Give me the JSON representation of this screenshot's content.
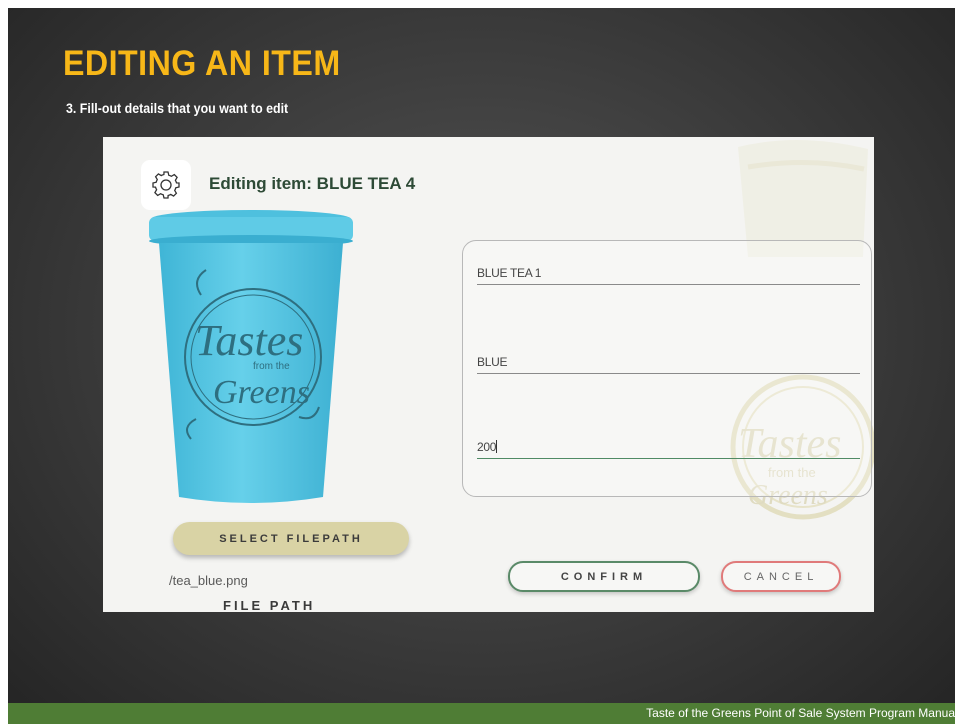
{
  "slide": {
    "title": "EDITING AN ITEM",
    "subtitle": "3.  Fill-out details that you want to edit",
    "footer": "Taste of the Greens Point of Sale System Program Manua"
  },
  "app": {
    "window_title": "Editing item: BLUE TEA 4",
    "settings_icon": "gear-icon",
    "product_image": "blue-cup-image",
    "logo_text": {
      "line1": "Tastes",
      "line2": "from the",
      "line3": "Greens"
    },
    "select_filepath_label": "SELECT FILEPATH",
    "filepath_value": "/tea_blue.png",
    "filepath_label": "FILE PATH",
    "fields": [
      {
        "value": "BLUE TEA 1"
      },
      {
        "value": "BLUE"
      },
      {
        "value": "200"
      }
    ],
    "confirm_label": "CONFIRM",
    "cancel_label": "CANCEL",
    "colors": {
      "title_yellow": "#f7b718",
      "footer_green": "#4f7d35",
      "cup_blue": "#5cc8e4",
      "confirm_border": "#5a8a68",
      "cancel_border": "#e07a7a",
      "filepath_button": "#d9d3a5"
    }
  }
}
